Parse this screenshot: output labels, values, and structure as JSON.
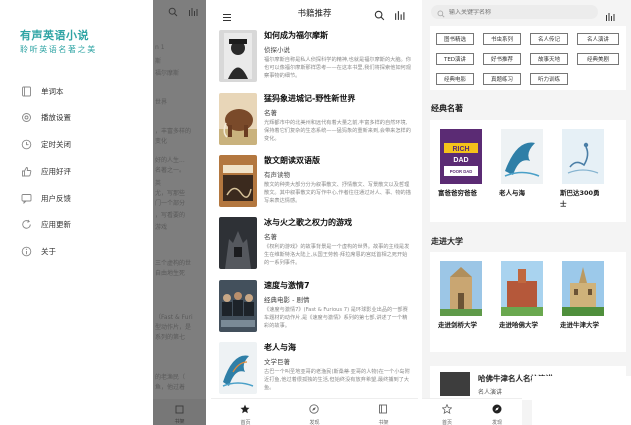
{
  "drawer": {
    "title": "有声英语小说",
    "subtitle": "聆听英语名著之美",
    "items": [
      {
        "label": "单词本",
        "icon": "book-icon"
      },
      {
        "label": "播放设置",
        "icon": "settings-icon"
      },
      {
        "label": "定时关闭",
        "icon": "clock-icon"
      },
      {
        "label": "应用好评",
        "icon": "thumbs-up-icon"
      },
      {
        "label": "用户反馈",
        "icon": "feedback-icon"
      },
      {
        "label": "应用更新",
        "icon": "update-icon"
      },
      {
        "label": "关于",
        "icon": "info-icon"
      }
    ],
    "ghost_lines": [
      "n 1",
      "斯",
      "福尔摩斯",
      "世界",
      "，丰富多样的",
      "变化",
      "好的人生...",
      "名著之一。",
      "英",
      "尤，写那些",
      "门一个部分",
      "，写看要的",
      "游戏",
      "三个虚构的世",
      "自由地生死",
      "（Fast & Furi",
      "型动作片，是",
      "系列的第七",
      "的老渔民（",
      "鱼，他过着"
    ],
    "ghost_nav_label": "书架"
  },
  "books_screen": {
    "title": "书籍推荐",
    "books": [
      {
        "title": "如何成为福尔摩斯",
        "type": "侦探小说",
        "desc": "福尔摩斯自称是私人侦探科学的精神,也就是福尔摩斯的大脑。你也可以像福尔摩斯那样思考——在这本书里,我们将探索他如何观察事物的细节。"
      },
      {
        "title": "猛犸象进城记-野性新世界",
        "type": "名著",
        "desc": "光辉都市中的北美州和远代有着大量之前,丰富多样的自然环境,保持着它们复杂的生态系统——猛犸象的重新来到,会带来怎样的变化。"
      },
      {
        "title": "散文朗读双语版",
        "type": "有声读物",
        "desc": "散文的种类大部分分为叙事散文、抒情散文、写景散文以及哲理散文。其中叙事散文的写作中心,作者往往通过对人、事、物的描写来表达情感。"
      },
      {
        "title": "冰与火之歌之权力的游戏",
        "type": "名著",
        "desc": "《权利的游戏》的故事背景是一个虚构的世界。故事的主线是发生在维斯特洛大陆上,从国王劳勃·拜拉席恩的宫廷首相之死开始的一系列事件。"
      },
      {
        "title": "速度与激情7",
        "type": "经典电影 - 剧情",
        "desc": "《速度与激情7》(Fast & Furious 7) 是环球影业出品的一部赛车题材的动作片,是《速度与激情》系列的第七部,讲述了一个精彩的故事。"
      },
      {
        "title": "老人与海",
        "type": "文学巨著",
        "desc": "古巴一个叫圣地亚哥的老渔民(斯桑蒂·亚哥的人物)在一个小岛附近打鱼,他过着很孤独的生活,但始终没有放弃希望,最终捕到了大鱼。"
      }
    ],
    "nav": [
      {
        "label": "首页",
        "icon": "star-icon"
      },
      {
        "label": "发现",
        "icon": "compass-icon"
      },
      {
        "label": "书架",
        "icon": "bookshelf-icon"
      }
    ]
  },
  "discover_screen": {
    "search_placeholder": "输入关键字名称",
    "tags": [
      "图书精选",
      "书虫系列",
      "名人传记",
      "名人演讲",
      "TED演讲",
      "好书推荐",
      "故事天地",
      "经典美剧",
      "经典电影",
      "真题练习",
      "听力训练"
    ],
    "sections": [
      {
        "title": "经典名著",
        "books": [
          {
            "title": "富爸爸穷爸爸",
            "cover_text": "RICH DAD POOR DAD"
          },
          {
            "title": "老人与海",
            "cover_text": ""
          },
          {
            "title": "斯巴达300勇士",
            "cover_text": ""
          }
        ]
      },
      {
        "title": "走进大学",
        "books": [
          {
            "title": "走进剑桥大学",
            "cover_text": ""
          },
          {
            "title": "走进哈佛大学",
            "cover_text": ""
          },
          {
            "title": "走进牛津大学",
            "cover_text": ""
          }
        ]
      }
    ],
    "partial_item": {
      "title": "哈佛牛津名人名校演讲",
      "sub": "名人演讲"
    },
    "nav": [
      {
        "label": "首页",
        "icon": "star-icon"
      },
      {
        "label": "发现",
        "icon": "compass-icon"
      }
    ]
  },
  "colors": {
    "accent": "#2fa4a4",
    "dim_overlay": "#7e7e7e"
  }
}
